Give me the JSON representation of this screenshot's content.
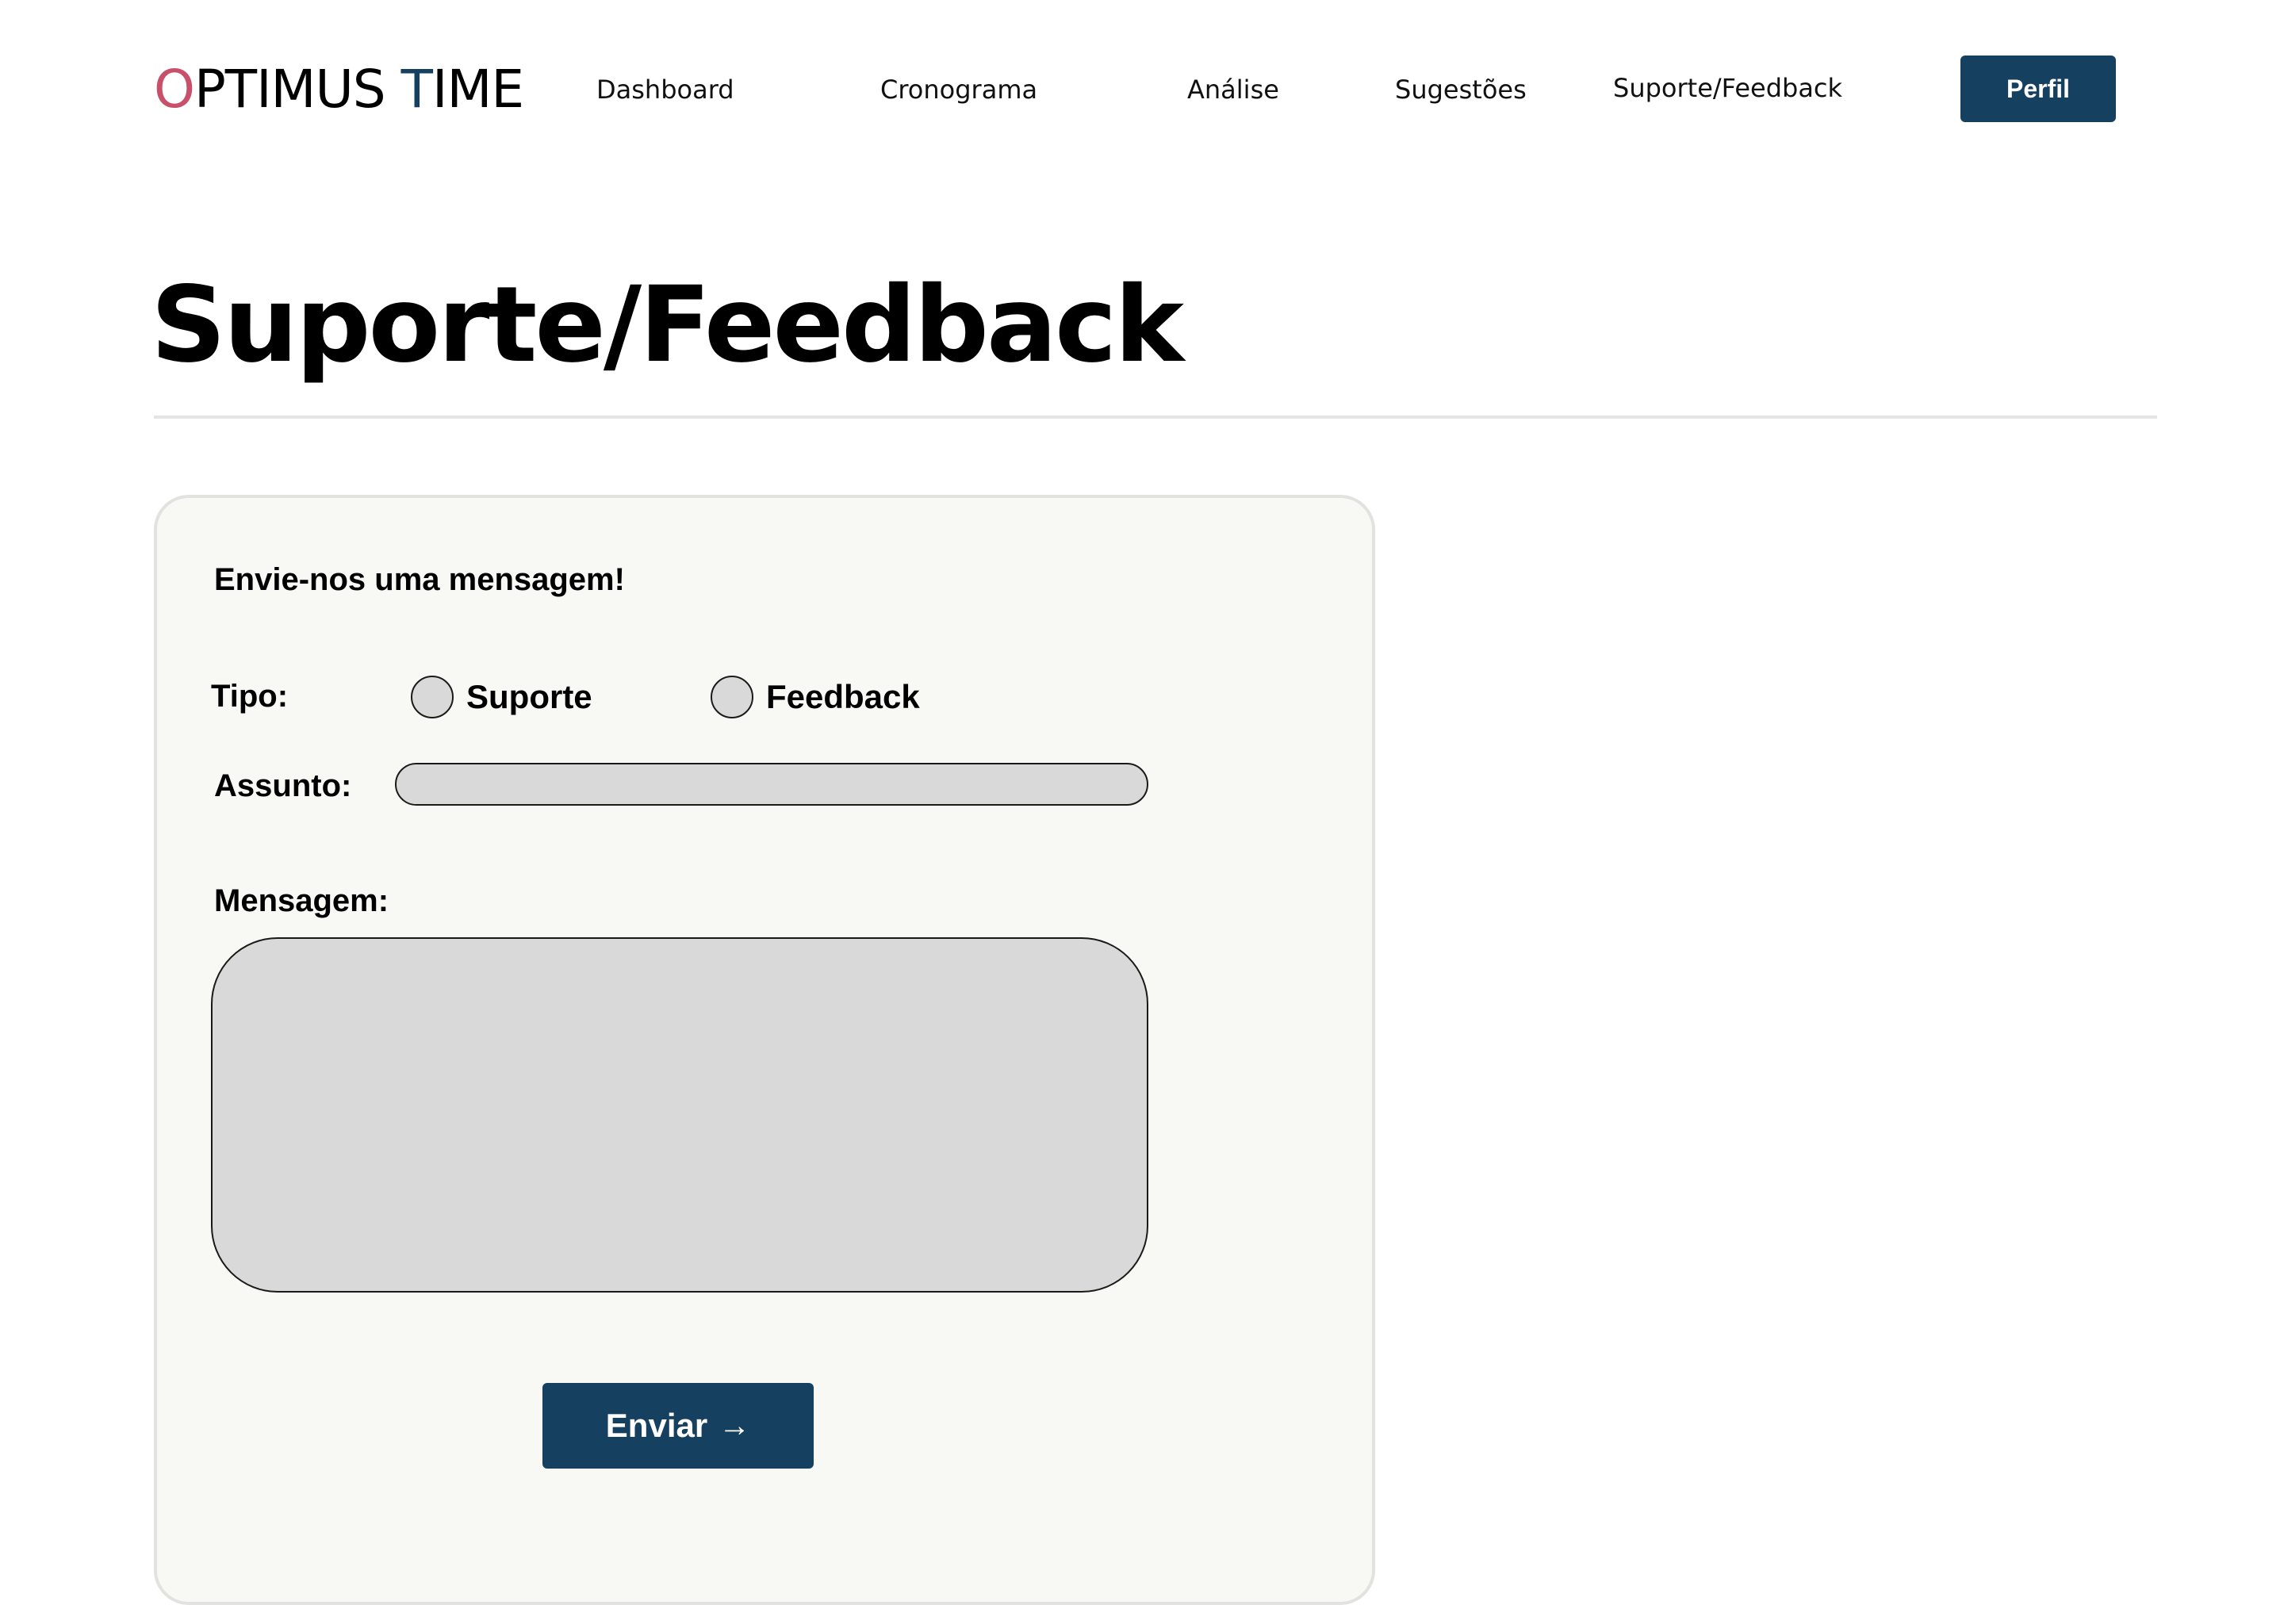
{
  "header": {
    "logo": {
      "first_letter": "O",
      "part1": "PTIMUS ",
      "second_letter": "T",
      "part2": "IME"
    },
    "nav": [
      {
        "label": "Dashboard"
      },
      {
        "label": "Cronograma"
      },
      {
        "label": "Análise"
      },
      {
        "label": "Sugestões"
      },
      {
        "label": "Suporte/Feedback"
      }
    ],
    "profile_button": "Perfil"
  },
  "page": {
    "title": "Suporte/Feedback"
  },
  "form": {
    "heading": "Envie-nos uma mensagem!",
    "type_label": "Tipo:",
    "type_options": [
      {
        "label": "Suporte"
      },
      {
        "label": "Feedback"
      }
    ],
    "subject_label": "Assunto:",
    "subject_value": "",
    "message_label": "Mensagem:",
    "message_value": "",
    "submit_label": "Enviar",
    "submit_icon": "arrow-right-icon"
  },
  "colors": {
    "brand": "#154060",
    "logo_accent": "#c8506b",
    "card_bg": "#f8f8f4",
    "field_bg": "#d9d9d9"
  }
}
